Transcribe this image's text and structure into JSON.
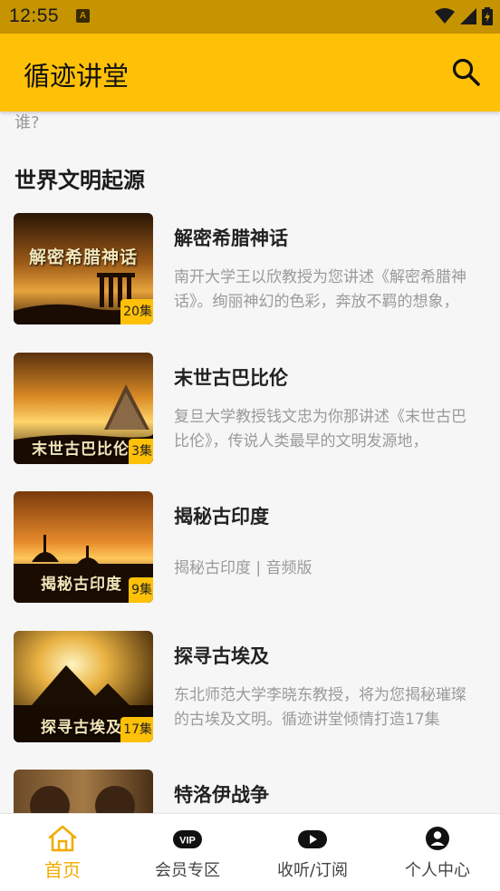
{
  "status_bar": {
    "time": "12:55",
    "notification_icon": "A"
  },
  "app_bar": {
    "title": "循迹讲堂"
  },
  "content": {
    "prev_text": "谁?",
    "section_title": "世界文明起源",
    "items": [
      {
        "title": "解密希腊神话",
        "thumb_caption": "解密希腊神话",
        "episodes": "20集",
        "desc": "南开大学王以欣教授为您讲述《解密希腊神话》。绚丽神幻的色彩，奔放不羁的想象，"
      },
      {
        "title": "末世古巴比伦",
        "thumb_caption": "末世古巴比伦",
        "episodes": "3集",
        "desc": "复旦大学教授钱文忠为你那讲述《末世古巴比伦》，传说人类最早的文明发源地，"
      },
      {
        "title": "揭秘古印度",
        "thumb_caption": "揭秘古印度",
        "episodes": "9集",
        "desc": "揭秘古印度 | 音频版"
      },
      {
        "title": "探寻古埃及",
        "thumb_caption": "探寻古埃及",
        "episodes": "17集",
        "desc": "东北师范大学李晓东教授，将为您揭秘璀璨的古埃及文明。循迹讲堂倾情打造17集"
      },
      {
        "title": "特洛伊战争",
        "thumb_caption": "",
        "episodes": "",
        "desc": ""
      }
    ]
  },
  "tab_bar": {
    "tabs": [
      {
        "label": "首页",
        "icon": "home-icon",
        "active": true
      },
      {
        "label": "会员专区",
        "icon": "vip-icon",
        "active": false
      },
      {
        "label": "收听/订阅",
        "icon": "play-icon",
        "active": false
      },
      {
        "label": "个人中心",
        "icon": "user-icon",
        "active": false
      }
    ]
  },
  "colors": {
    "accent": "#ffc107",
    "status_bar": "#c69400",
    "active_tab": "#f2ac00",
    "background": "#f6f6f6"
  }
}
